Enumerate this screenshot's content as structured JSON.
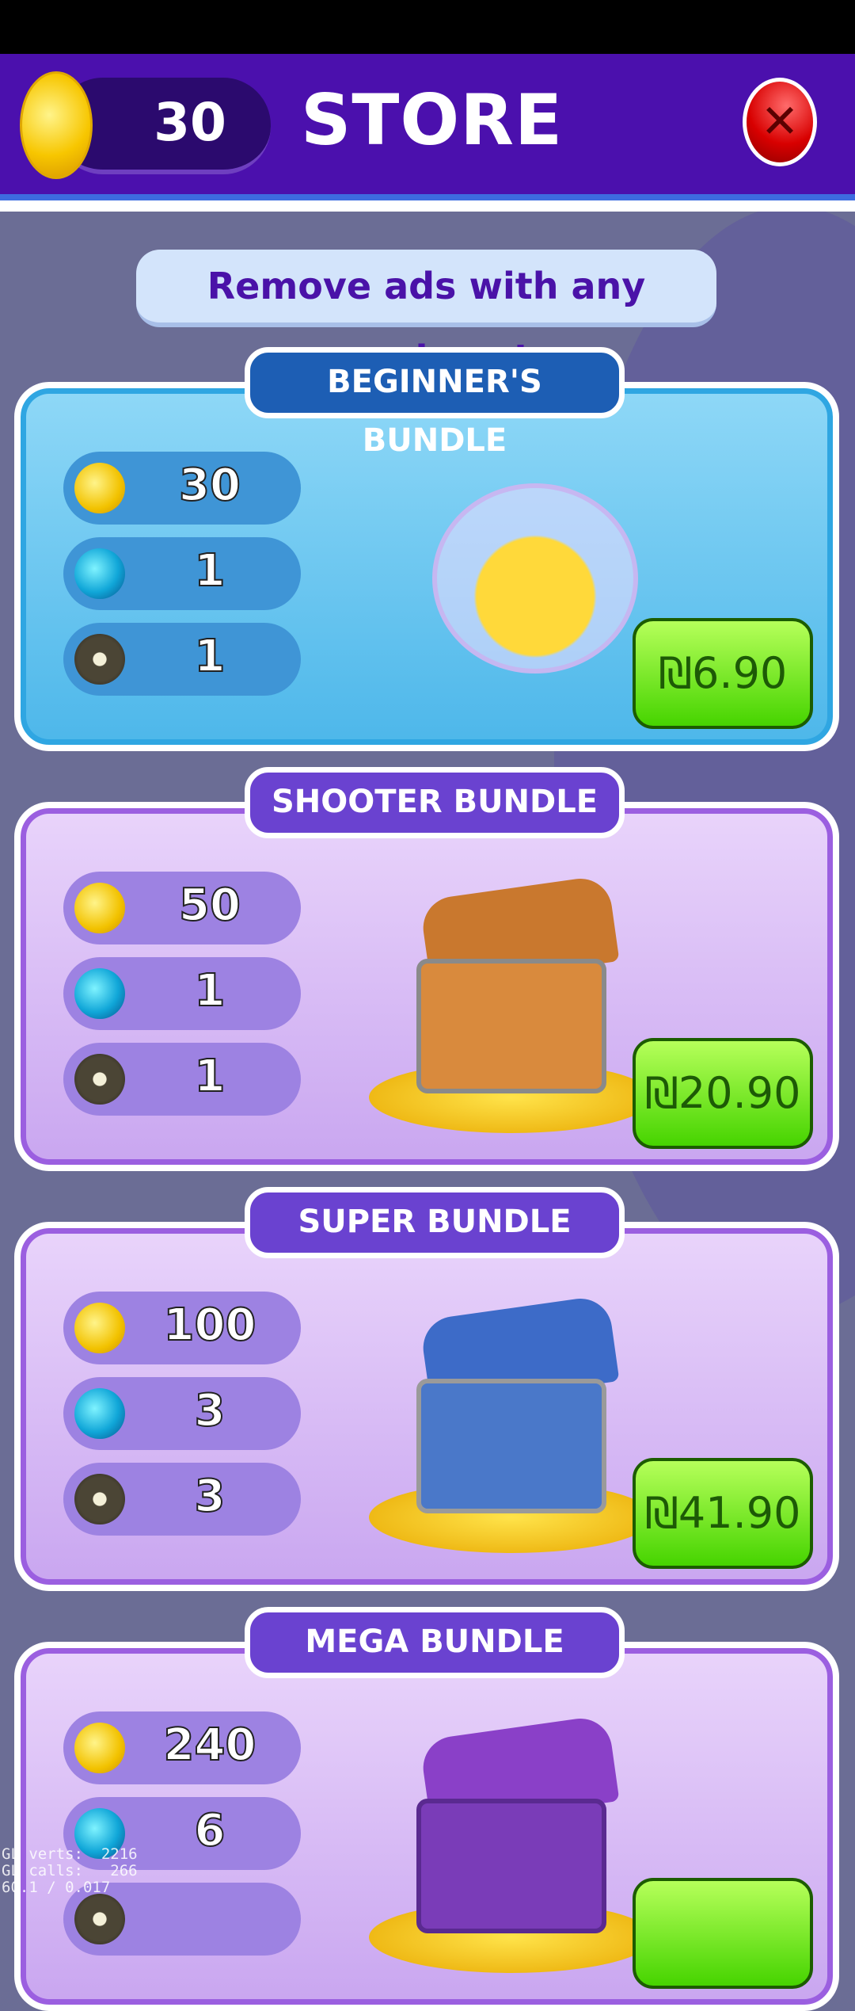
{
  "header": {
    "coins": "30",
    "title": "STORE",
    "close_icon": "close-x-icon"
  },
  "banner": "Remove ads with any purchase!",
  "bundles": [
    {
      "title": "BEGINNER'S BUNDLE",
      "theme": "blue",
      "coins": "30",
      "orbs": "1",
      "bombs": "1",
      "price": "₪6.90"
    },
    {
      "title": "SHOOTER BUNDLE",
      "theme": "purple",
      "coins": "50",
      "orbs": "1",
      "bombs": "1",
      "price": "₪20.90"
    },
    {
      "title": "SUPER BUNDLE",
      "theme": "purple",
      "coins": "100",
      "orbs": "3",
      "bombs": "3",
      "price": "₪41.90"
    },
    {
      "title": "MEGA BUNDLE",
      "theme": "purple",
      "coins": "240",
      "orbs": "6",
      "bombs": "",
      "price": ""
    }
  ],
  "debug": [
    "GL verts:  2216",
    "GL calls:   266",
    "60.1 / 0.017"
  ],
  "colors": {
    "header": "#4b10ad",
    "price_button": "#46d400",
    "blue_card": "#4db7ea",
    "purple_card": "#c9a6f0"
  }
}
